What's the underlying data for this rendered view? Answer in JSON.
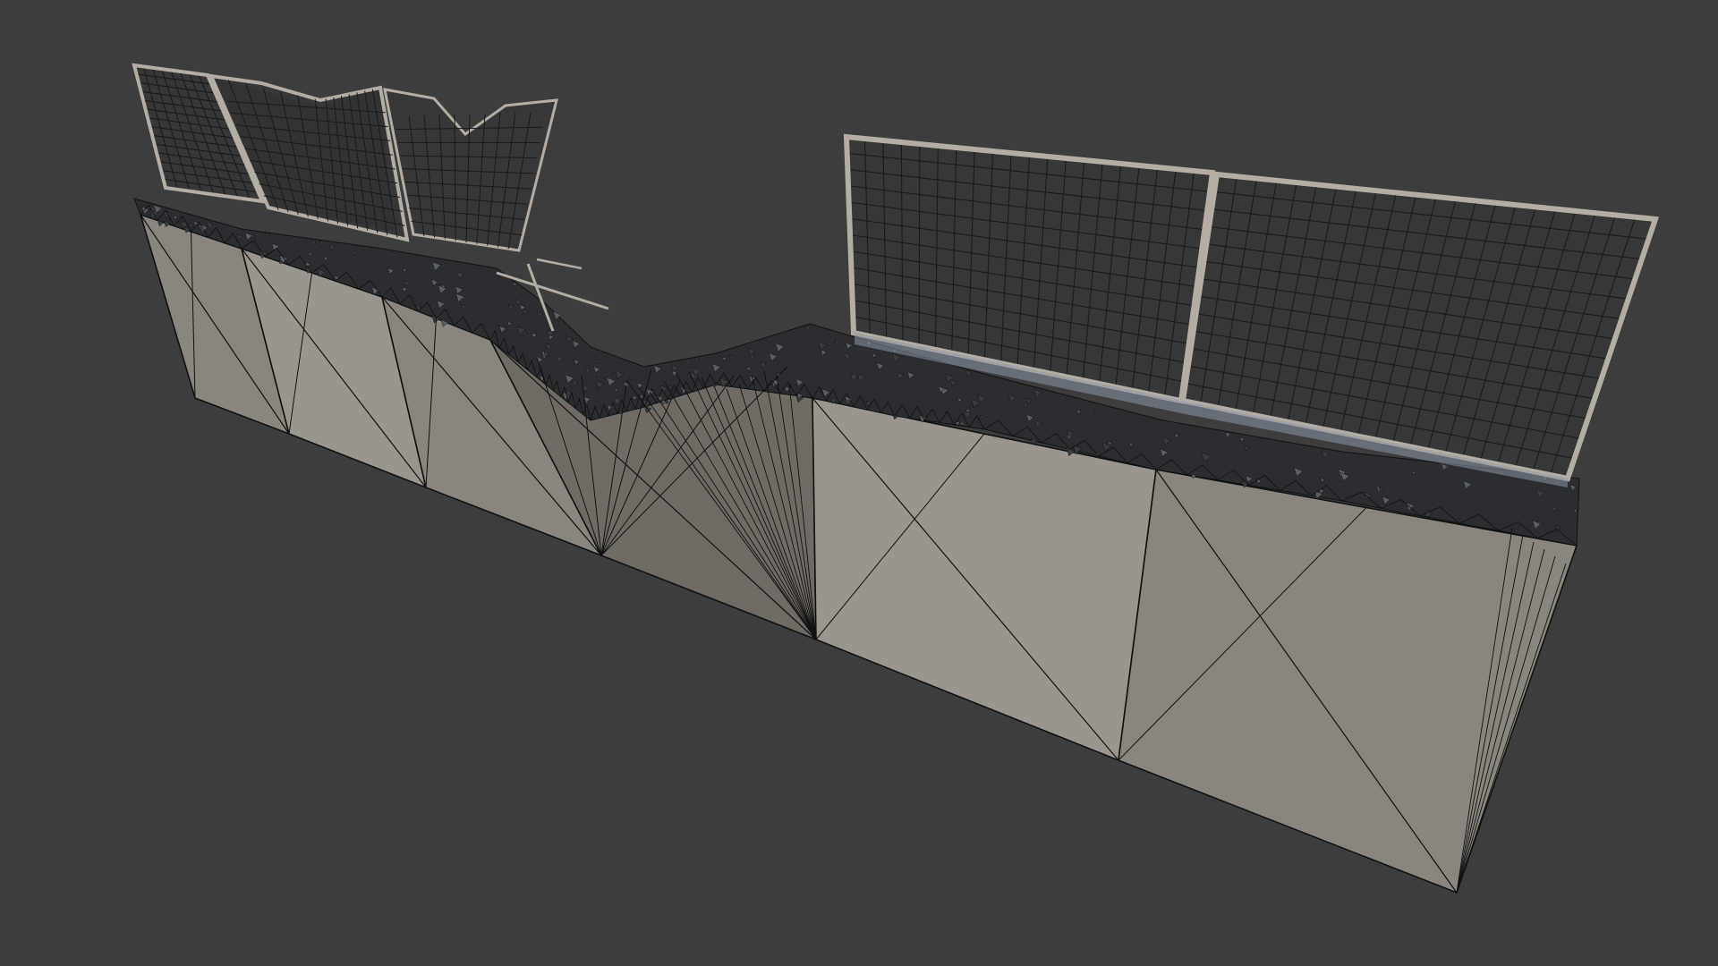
{
  "viewport": {
    "background_color": "#3d3d3d",
    "render_mode": "shaded-wireframe"
  },
  "model": {
    "name": "",
    "segment_count": 5,
    "wall_color": "#8a867e",
    "wall_color_light": "#9a968d",
    "wall_color_shadow": "#6f6b64",
    "wire_color": "#111111",
    "rubble_color": "#2b2d31",
    "fence_frame_color": "#b3ada3",
    "fence_grid_color": "#1a1a1a",
    "fence_left_state": "damaged",
    "fence_right_state": "intact"
  }
}
